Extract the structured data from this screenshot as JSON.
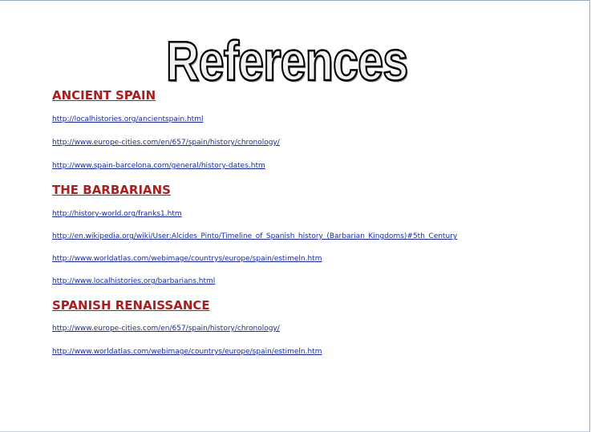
{
  "title": "References",
  "sections": [
    {
      "heading": "ANCIENT SPAIN",
      "links": [
        "http://localhistories.org/ancientspain.html",
        "http://www.europe-cities.com/en/657/spain/history/chronology/",
        "http://www.spain-barcelona.com/general/history-dates.htm"
      ]
    },
    {
      "heading": "THE BARBARIANS",
      "links": [
        "http://history-world.org/franks1.htm",
        "http://en.wikipedia.org/wiki/User:Alcides_Pinto/Timeline_of_Spanish_history_(Barbarian_Kingdoms)#5th_Century",
        "http://www.worldatlas.com/webimage/countrys/europe/spain/estimeln.htm",
        "http://www.localhistories.org/barbarians.html"
      ]
    },
    {
      "heading": "SPANISH RENAISSANCE",
      "links": [
        "http://www.europe-cities.com/en/657/spain/history/chronology/",
        "http://www.worldatlas.com/webimage/countrys/europe/spain/estimeln.htm"
      ]
    }
  ]
}
